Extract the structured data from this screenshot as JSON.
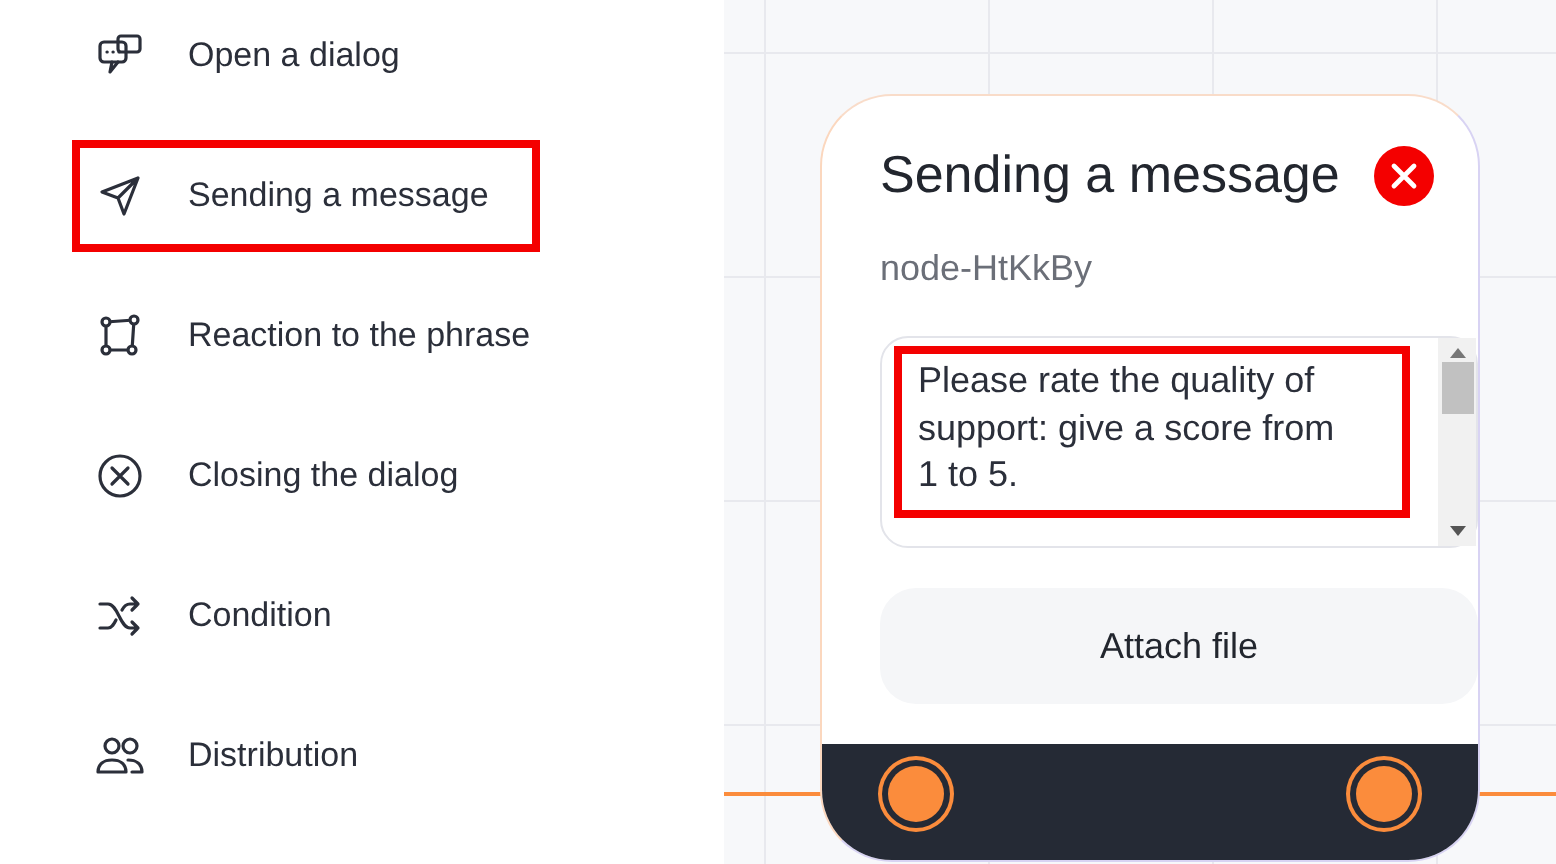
{
  "sidebar": {
    "items": [
      {
        "label": "Open a dialog",
        "highlighted": false
      },
      {
        "label": "Sending a message",
        "highlighted": true
      },
      {
        "label": "Reaction to the phrase",
        "highlighted": false
      },
      {
        "label": "Closing the dialog",
        "highlighted": false
      },
      {
        "label": "Condition",
        "highlighted": false
      },
      {
        "label": "Distribution",
        "highlighted": false
      }
    ]
  },
  "node": {
    "title": "Sending a message",
    "id": "node-HtKkBy",
    "message": {
      "text": "Please rate the quality of support: give a score from 1 to 5.",
      "highlighted": true
    },
    "attach_button": "Attach file"
  }
}
